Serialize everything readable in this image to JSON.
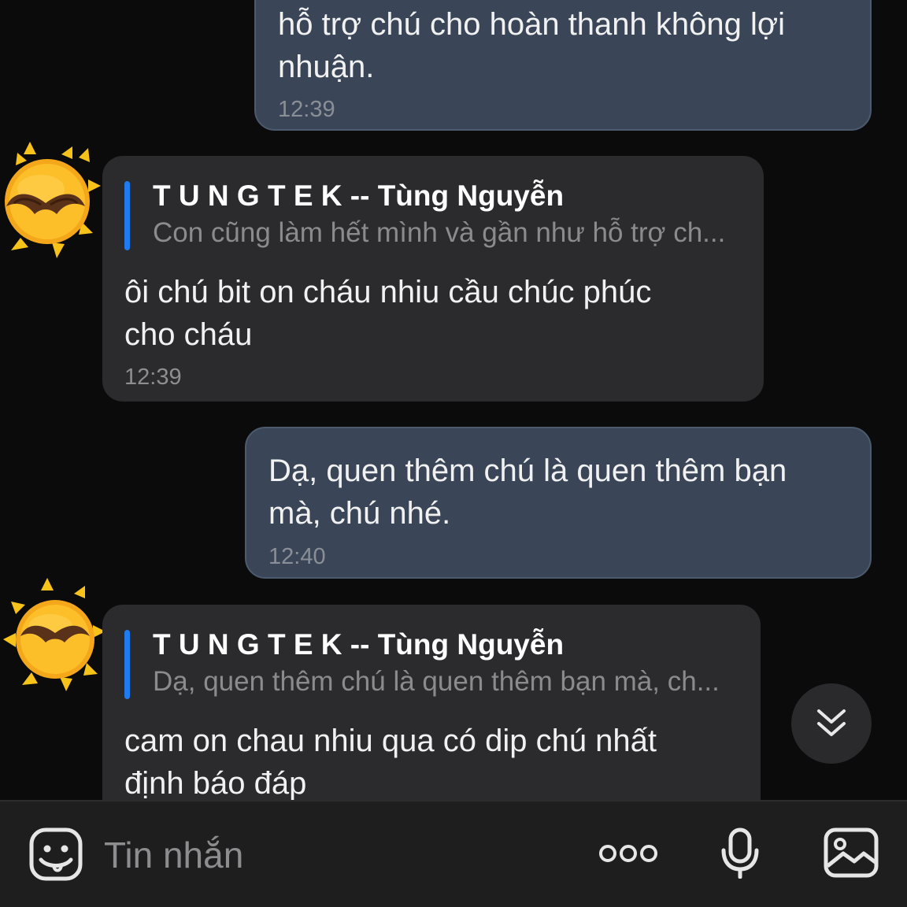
{
  "messages": [
    {
      "direction": "outgoing",
      "text": "hỗ trợ chú cho hoàn thanh không lợi\nnhuận.",
      "time": "12:39"
    },
    {
      "direction": "incoming",
      "reply_to": {
        "name": "T U N G T E K -- Tùng Nguyễn",
        "text": "Con cũng làm hết mình và gần như hỗ trợ ch..."
      },
      "text": "ôi chú bit on cháu nhiu cầu chúc phúc\ncho cháu",
      "time": "12:39"
    },
    {
      "direction": "outgoing",
      "text": "Dạ, quen thêm chú là quen thêm bạn\nmà, chú nhé.",
      "time": "12:40"
    },
    {
      "direction": "incoming",
      "reply_to": {
        "name": "T U N G T E K -- Tùng Nguyễn",
        "text": "Dạ, quen thêm chú là quen thêm bạn mà, ch..."
      },
      "text": "cam on chau nhiu qua có dip chú nhất\nđịnh báo đáp"
    }
  ],
  "composer": {
    "placeholder": "Tin nhắn",
    "icons": [
      "emoji-sticker-icon",
      "more-dots-icon",
      "microphone-icon",
      "image-gallery-icon"
    ]
  },
  "scroll_button_icon": "double-chevron-down-icon",
  "avatar_icon": "sun-mustache-avatar-icon",
  "colors": {
    "background": "#0b0b0c",
    "outgoing_bubble": "#3a4657",
    "incoming_bubble": "#2b2b2d",
    "reply_bar": "#1e7bf0",
    "composer": "#1e1e1f"
  }
}
